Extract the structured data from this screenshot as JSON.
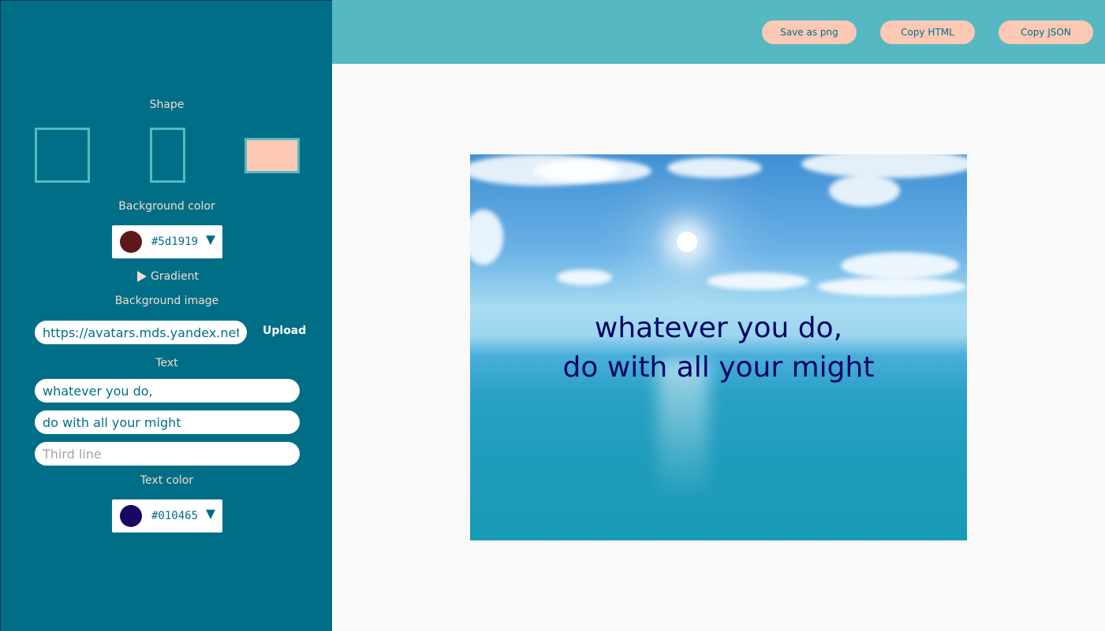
{
  "toolbar": {
    "save_png": "Save as png",
    "copy_html": "Copy HTML",
    "copy_json": "Copy JSON"
  },
  "sidebar": {
    "shape_label": "Shape",
    "shapes": [
      {
        "name": "square",
        "selected": false
      },
      {
        "name": "portrait",
        "selected": false
      },
      {
        "name": "landscape",
        "selected": true
      }
    ],
    "background_color_label": "Background color",
    "background_color": "#5d1919",
    "gradient_label": "Gradient",
    "background_image_label": "Background image",
    "background_image_url": "https://avatars.mds.yandex.net/",
    "upload_label": "Upload",
    "text_label": "Text",
    "text_line_1": "whatever you do,",
    "text_line_2": "do with all your might",
    "text_line_3": "",
    "text_line_3_placeholder": "Third line",
    "text_color_label": "Text color",
    "text_color": "#010465"
  },
  "canvas": {
    "line_1": "whatever you do,",
    "line_2": "do with all your might",
    "text_color": "#010465"
  },
  "colors": {
    "sidebar_bg": "#006e86",
    "topbar_bg": "#56b8c2",
    "button_bg": "#fdc9b4",
    "label_text": "#f2dcd0"
  }
}
